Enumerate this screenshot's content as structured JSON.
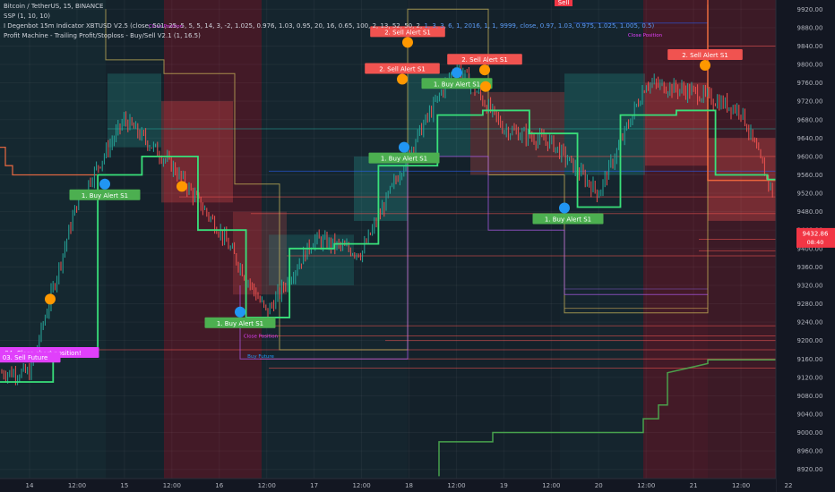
{
  "header": {
    "symbol_line": "Bitcoin / TetherUS, 15, BINANCE",
    "indicator_1": "SSP (1, 10, 10)",
    "indicator_2a": "I Degenbot 15m Indicator XBTUSD V2.5 (close, 501, 25, 5, 5, 5, 14, 3, -2, 1.025, 0.976, 1.03, 0.95, 20, 16, 0.65, 100, 2, 13, 52, 50, 2,",
    "indicator_2b": "1, 3, 3, 6, 1, 2016, 1, 1, 9999, close, 0.97, 1.03, 0.975, 1.025, 1.005, 0.5)",
    "indicator_3": "Profit Machine - Trailing Profit/Stoploss - Buy/Sell V2.1 (1, 16.5)"
  },
  "price_axis": {
    "ticks": [
      "9920.00",
      "9880.00",
      "9840.00",
      "9800.00",
      "9760.00",
      "9720.00",
      "9680.00",
      "9640.00",
      "9600.00",
      "9560.00",
      "9520.00",
      "9480.00",
      "9440.00",
      "9400.00",
      "9360.00",
      "9320.00",
      "9280.00",
      "9240.00",
      "9200.00",
      "9160.00",
      "9120.00",
      "9080.00",
      "9040.00",
      "9000.00",
      "8960.00",
      "8920.00"
    ],
    "current_price": "9432.86",
    "countdown": "08:40",
    "current_color": "#f23645"
  },
  "time_axis": [
    "14",
    "12:00",
    "15",
    "12:00",
    "16",
    "12:00",
    "17",
    "12:00",
    "18",
    "12:00",
    "19",
    "12:00",
    "20",
    "12:00",
    "21",
    "12:00",
    "22"
  ],
  "signals": {
    "buy": [
      {
        "label": "1. Buy Alert S1",
        "price": 9540
      },
      {
        "label": "1. Buy Alert S1",
        "price": 9262
      },
      {
        "label": "1. Buy Alert S1",
        "price": 9620
      },
      {
        "label": "1. Buy Alert S1",
        "price": 9782
      },
      {
        "label": "1. Buy Alert S1",
        "price": 9488
      }
    ],
    "sell": [
      {
        "label": "2. Sell Alert S1",
        "price": 9848
      },
      {
        "label": "2. Sell Alert S1",
        "price": 9768
      },
      {
        "label": "2. Sell Alert S1",
        "price": 9788
      },
      {
        "label": "2. Sell Alert S1",
        "price": 9798
      }
    ],
    "sell_top": "Sell",
    "close_position": "Close Position",
    "buy_future": "Buy Future",
    "short_label_1": "04. Close short position!",
    "short_label_2": "03. Sell Future"
  },
  "colors": {
    "bull_candle": "#26a69a",
    "bear_candle": "#ef5350",
    "trail_green": "#39e07a",
    "buy_dot": "#2196f3",
    "sell_dot": "#ff9800",
    "buy_label": "#4caf50",
    "sell_label": "#f05350",
    "magenta": "#e040fb"
  },
  "chart_data": {
    "type": "line",
    "title": "Bitcoin / TetherUS, 15, BINANCE",
    "xlabel": "",
    "ylabel": "",
    "ylim": [
      8900,
      9940
    ],
    "x": [
      "14",
      "12:00",
      "15",
      "12:00",
      "16",
      "12:00",
      "17",
      "12:00",
      "18",
      "12:00",
      "19",
      "12:00",
      "20",
      "12:00",
      "21",
      "12:00",
      "22"
    ],
    "series": [
      {
        "name": "price",
        "values": [
          9130,
          9500,
          9680,
          9580,
          9440,
          9260,
          9420,
          9390,
          9610,
          9800,
          9660,
          9630,
          9520,
          9760,
          9740,
          9700,
          9430
        ]
      },
      {
        "name": "trailing",
        "values": [
          9110,
          9180,
          9560,
          9600,
          9440,
          9250,
          9400,
          9410,
          9580,
          9690,
          9700,
          9650,
          9490,
          9690,
          9700,
          9560,
          9550
        ]
      }
    ],
    "grid": true,
    "legend": "top-left"
  }
}
